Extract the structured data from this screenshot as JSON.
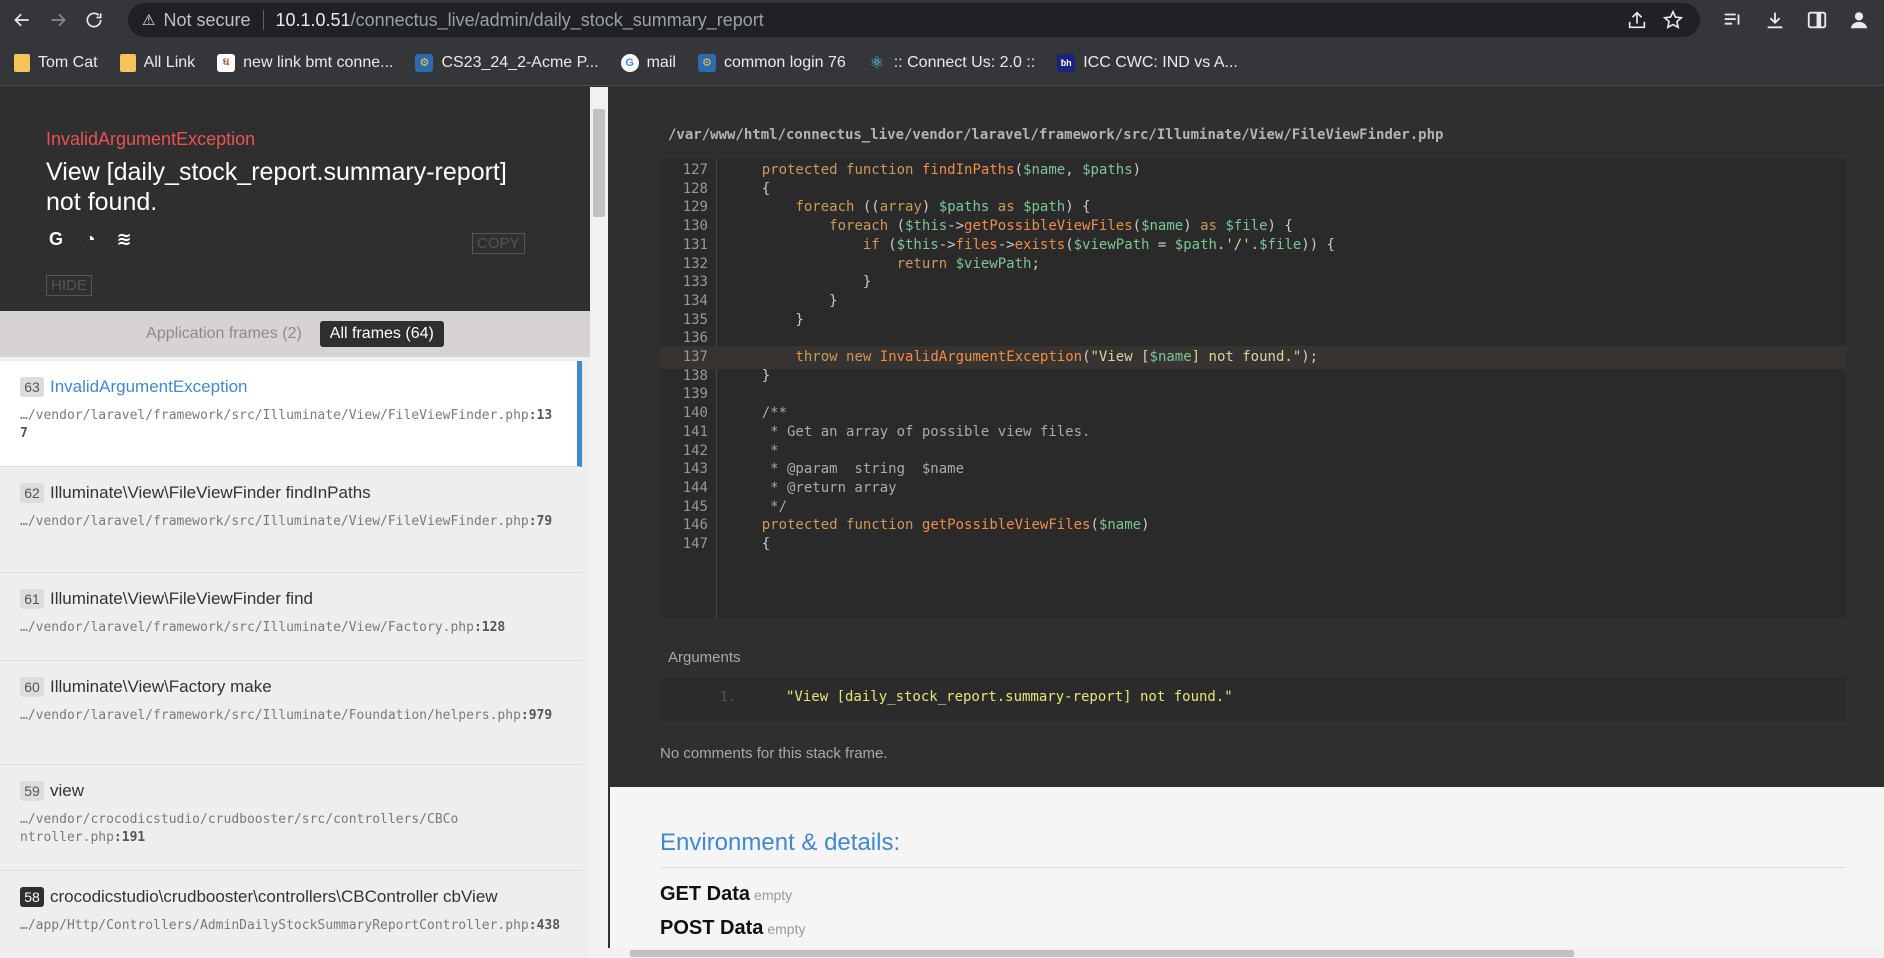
{
  "browser": {
    "security_label": "Not secure",
    "url_host": "10.1.0.51",
    "url_path": "/connectus_live/admin/daily_stock_summary_report",
    "bookmarks": [
      {
        "label": "Tom Cat",
        "icon": "folder-icon"
      },
      {
        "label": "All Link",
        "icon": "folder-icon"
      },
      {
        "label": "new link bmt conne...",
        "icon": "site-icon"
      },
      {
        "label": "CS23_24_2-Acme P...",
        "icon": "site-icon"
      },
      {
        "label": "mail",
        "icon": "google-icon"
      },
      {
        "label": "common login 76",
        "icon": "site-icon"
      },
      {
        "label": ":: Connect Us: 2.0 ::",
        "icon": "react-icon"
      },
      {
        "label": "ICC CWC: IND vs A...",
        "icon": "site-icon"
      }
    ]
  },
  "exception": {
    "class": "InvalidArgumentException",
    "message": "View [daily_stock_report.summary-report] not found.",
    "copy_label": "COPY",
    "hide_label": "HIDE"
  },
  "frame_filter": {
    "application": "Application frames (2)",
    "all": "All frames (64)"
  },
  "frames": [
    {
      "index": "63",
      "name": "InvalidArgumentException",
      "file": "…/vendor/laravel/framework/src/Illuminate/View/FileViewFinder.php",
      "line": ":137"
    },
    {
      "index": "62",
      "name": "Illuminate\\View\\FileViewFinder findInPaths",
      "file": "…/vendor/laravel/framework/src/Illuminate/View/FileViewFinder.php",
      "line": ":79"
    },
    {
      "index": "61",
      "name": "Illuminate\\View\\FileViewFinder find",
      "file": "…/vendor/laravel/framework/src/Illuminate/View/Factory.php",
      "line": ":128"
    },
    {
      "index": "60",
      "name": "Illuminate\\View\\Factory make",
      "file": "…/vendor/laravel/framework/src/Illuminate/Foundation/helpers.php",
      "line": ":979"
    },
    {
      "index": "59",
      "name": "view",
      "file": "…/vendor/crocodicstudio/crudbooster/src/controllers/CBController.php",
      "line": ":191"
    },
    {
      "index": "58",
      "name": "crocodicstudio\\crudbooster\\controllers\\CBController cbView",
      "file": "…/app/Http/Controllers/AdminDailyStockSummaryReportController.php",
      "line": ":438"
    }
  ],
  "code": {
    "path": "/var/www/html/connectus_live/vendor/laravel/framework/src/Illuminate/View/FileViewFinder.php",
    "lines": [
      {
        "n": "127",
        "t": "    protected function findInPaths($name, $paths)"
      },
      {
        "n": "128",
        "t": "    {"
      },
      {
        "n": "129",
        "t": "        foreach ((array) $paths as $path) {"
      },
      {
        "n": "130",
        "t": "            foreach ($this->getPossibleViewFiles($name) as $file) {"
      },
      {
        "n": "131",
        "t": "                if ($this->files->exists($viewPath = $path.'/'.$file)) {"
      },
      {
        "n": "132",
        "t": "                    return $viewPath;"
      },
      {
        "n": "133",
        "t": "                }"
      },
      {
        "n": "134",
        "t": "            }"
      },
      {
        "n": "135",
        "t": "        }"
      },
      {
        "n": "136",
        "t": ""
      },
      {
        "n": "137",
        "t": "        throw new InvalidArgumentException(\"View [$name] not found.\");"
      },
      {
        "n": "138",
        "t": "    }"
      },
      {
        "n": "139",
        "t": ""
      },
      {
        "n": "140",
        "t": "    /**"
      },
      {
        "n": "141",
        "t": "     * Get an array of possible view files."
      },
      {
        "n": "142",
        "t": "     *"
      },
      {
        "n": "143",
        "t": "     * @param  string  $name"
      },
      {
        "n": "144",
        "t": "     * @return array"
      },
      {
        "n": "145",
        "t": "     */"
      },
      {
        "n": "146",
        "t": "    protected function getPossibleViewFiles($name)"
      },
      {
        "n": "147",
        "t": "    {"
      }
    ],
    "highlight_line": "137"
  },
  "arguments": {
    "title": "Arguments",
    "index": "1.",
    "value": "\"View [daily_stock_report.summary-report] not found.\""
  },
  "no_comments": "No comments for this stack frame.",
  "environment": {
    "title": "Environment & details:",
    "get_label": "GET Data",
    "get_value": "empty",
    "post_label": "POST Data",
    "post_value": "empty"
  }
}
